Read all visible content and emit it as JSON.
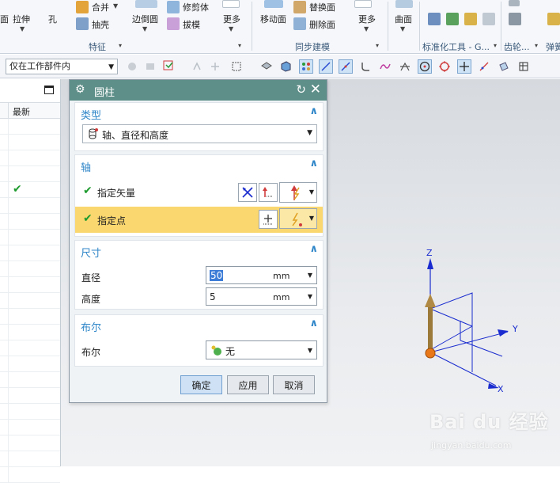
{
  "ribbon": {
    "extrude_label": "拉伸",
    "hole_label": "孔",
    "unite_label": "合并",
    "shell_label": "抽壳",
    "feature_group": "特征",
    "edge_blend_label": "边倒圆",
    "trim_body_label": "修剪体",
    "draft_label": "拔模",
    "more_label_1": "更多",
    "move_face_label": "移动面",
    "replace_face_label": "替换面",
    "delete_face_label": "删除面",
    "sync_group": "同步建模",
    "more_label_2": "更多",
    "surface_label": "曲面",
    "std_tools_group": "标准化工具 - G...",
    "gear_group": "齿轮...",
    "spring_group": "弹簧"
  },
  "toolbar2": {
    "filter_value": "仅在工作部件内"
  },
  "nav": {
    "column_header": "最新",
    "rows": [
      "",
      "",
      "",
      "",
      "✔",
      "",
      "",
      "",
      "",
      "",
      "",
      "",
      "",
      "",
      "",
      "",
      "",
      "",
      "",
      "",
      "",
      "",
      ""
    ]
  },
  "dialog": {
    "title": "圆柱",
    "type_section": "类型",
    "type_value": "轴、直径和高度",
    "axis_section": "轴",
    "specify_vector": "指定矢量",
    "specify_point": "指定点",
    "dims_section": "尺寸",
    "diameter_label": "直径",
    "diameter_value": "50",
    "diameter_unit": "mm",
    "height_label": "高度",
    "height_value": "5",
    "height_unit": "mm",
    "bool_section": "布尔",
    "bool_label": "布尔",
    "bool_value": "无",
    "ok": "确定",
    "apply": "应用",
    "cancel": "取消"
  },
  "triad": {
    "z": "Z",
    "y": "Y",
    "x": "X"
  },
  "watermark": {
    "logo": "Bai du 经验",
    "url": "jingyan.baidu.com"
  },
  "colors": {
    "dialog_title_bg": "#5f8f89",
    "section_header": "#2f86c8",
    "highlight_row": "#fbd76f",
    "check_green": "#1e9b2e",
    "axis_blue": "#1a2ccf"
  }
}
